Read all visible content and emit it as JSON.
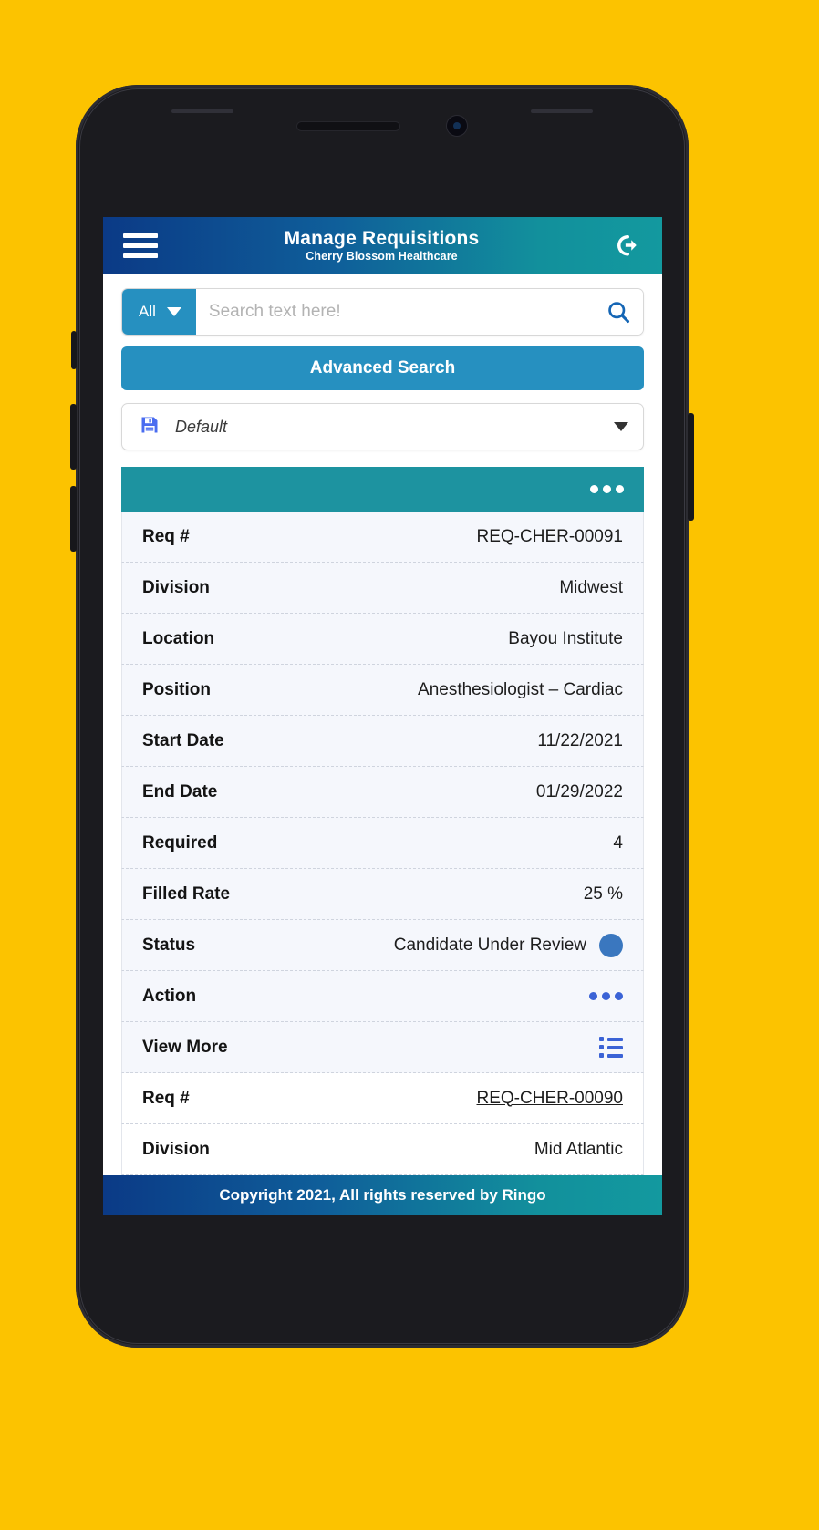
{
  "header": {
    "title": "Manage Requisitions",
    "subtitle": "Cherry Blossom Healthcare",
    "menu_icon": "hamburger-icon",
    "logout_icon": "logout-icon"
  },
  "search": {
    "scope_label": "All",
    "placeholder": "Search text here!",
    "value": "",
    "search_icon": "search-icon",
    "advanced_search_label": "Advanced Search"
  },
  "saved_view": {
    "label": "Default",
    "save_icon": "save-icon"
  },
  "results": {
    "toolbar_menu_icon": "ellipsis-icon",
    "cards": [
      {
        "rows": [
          {
            "label": "Req #",
            "value": "REQ-CHER-00091",
            "kind": "link"
          },
          {
            "label": "Division",
            "value": "Midwest",
            "kind": "text"
          },
          {
            "label": "Location",
            "value": "Bayou Institute",
            "kind": "text"
          },
          {
            "label": "Position",
            "value": "Anesthesiologist – Cardiac",
            "kind": "text"
          },
          {
            "label": "Start Date",
            "value": "11/22/2021",
            "kind": "text"
          },
          {
            "label": "End Date",
            "value": "01/29/2022",
            "kind": "text"
          },
          {
            "label": "Required",
            "value": "4",
            "kind": "text"
          },
          {
            "label": "Filled Rate",
            "value": "25  %",
            "kind": "text"
          },
          {
            "label": "Status",
            "value": "Candidate Under Review",
            "kind": "status",
            "status_color": "#3a77bf"
          },
          {
            "label": "Action",
            "value": "",
            "kind": "ellipsis"
          },
          {
            "label": "View More",
            "value": "",
            "kind": "list"
          }
        ]
      },
      {
        "rows": [
          {
            "label": "Req #",
            "value": "REQ-CHER-00090",
            "kind": "link"
          },
          {
            "label": "Division",
            "value": "Mid Atlantic",
            "kind": "text"
          }
        ]
      }
    ]
  },
  "footer": {
    "copyright": "Copyright 2021, All rights reserved by Ringo"
  },
  "colors": {
    "page_background": "#FCC300",
    "header_gradient_start": "#0b3a86",
    "header_gradient_end": "#13999f",
    "accent_blue": "#2690c0",
    "toolbar_teal": "#1d93a0",
    "status_blue": "#3a77bf",
    "icon_blue": "#3b63d6"
  }
}
